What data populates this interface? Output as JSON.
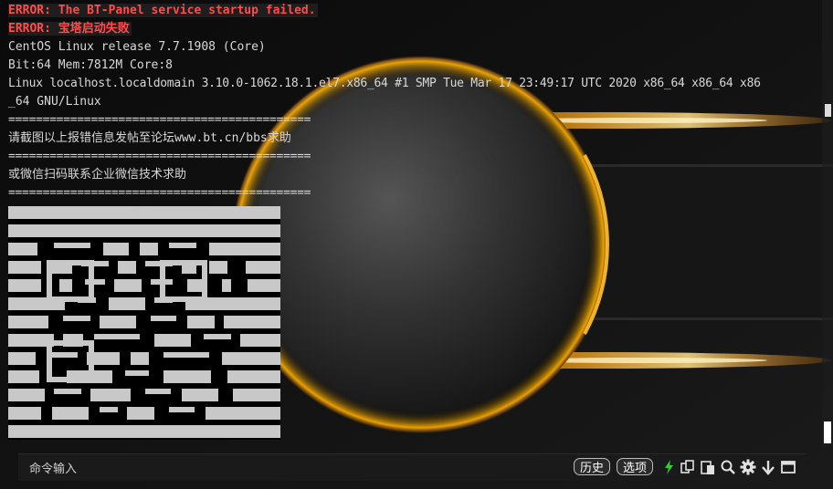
{
  "terminal": {
    "error_line_1": "ERROR: The BT-Panel service startup failed.",
    "error_line_2": "ERROR: 宝塔启动失败",
    "release_line": "CentOS Linux release 7.7.1908 (Core)",
    "hardware_line": "Bit:64 Mem:7812M Core:8",
    "kernel_line_1": "Linux localhost.localdomain 3.10.0-1062.18.1.el7.x86_64 #1 SMP Tue Mar 17 23:49:17 UTC 2020 x86_64 x86_64 x86",
    "kernel_line_2": "_64 GNU/Linux",
    "separator": "============================================",
    "help_forum": "请截图以上报错信息发帖至论坛www.bt.cn/bbs求助",
    "help_wechat": "或微信扫码联系企业微信技术求助"
  },
  "command_bar": {
    "input_placeholder": "命令输入",
    "history_label": "历史",
    "options_label": "选项"
  },
  "icons": [
    "bolt-icon",
    "copy-icon",
    "paste-icon",
    "search-icon",
    "gear-icon",
    "arrow-down-icon",
    "window-icon"
  ],
  "colors": {
    "error_text": "#ff4b4b",
    "bolt": "#33cc33",
    "glow": "#ffb000"
  }
}
